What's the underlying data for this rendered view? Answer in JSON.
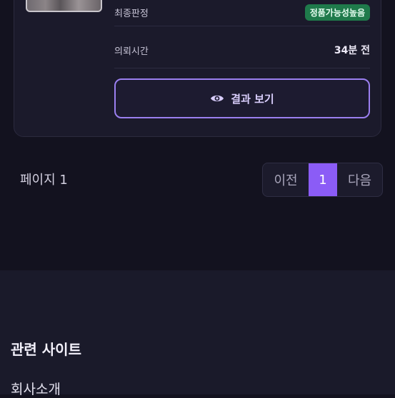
{
  "card": {
    "rows": [
      {
        "key": "최종판정",
        "badge": "정품가능성높음"
      },
      {
        "key": "의뢰시간",
        "value": "34분 전"
      }
    ],
    "result_button_label": "결과 보기"
  },
  "pagination": {
    "page_label": "페이지 1",
    "prev_label": "이전",
    "current_page": "1",
    "next_label": "다음"
  },
  "footer": {
    "title": "관련 사이트",
    "links": [
      "회사소개"
    ]
  },
  "colors": {
    "accent": "#8b5cf6",
    "badge_green": "#1f7a4b",
    "background": "#13121f"
  }
}
